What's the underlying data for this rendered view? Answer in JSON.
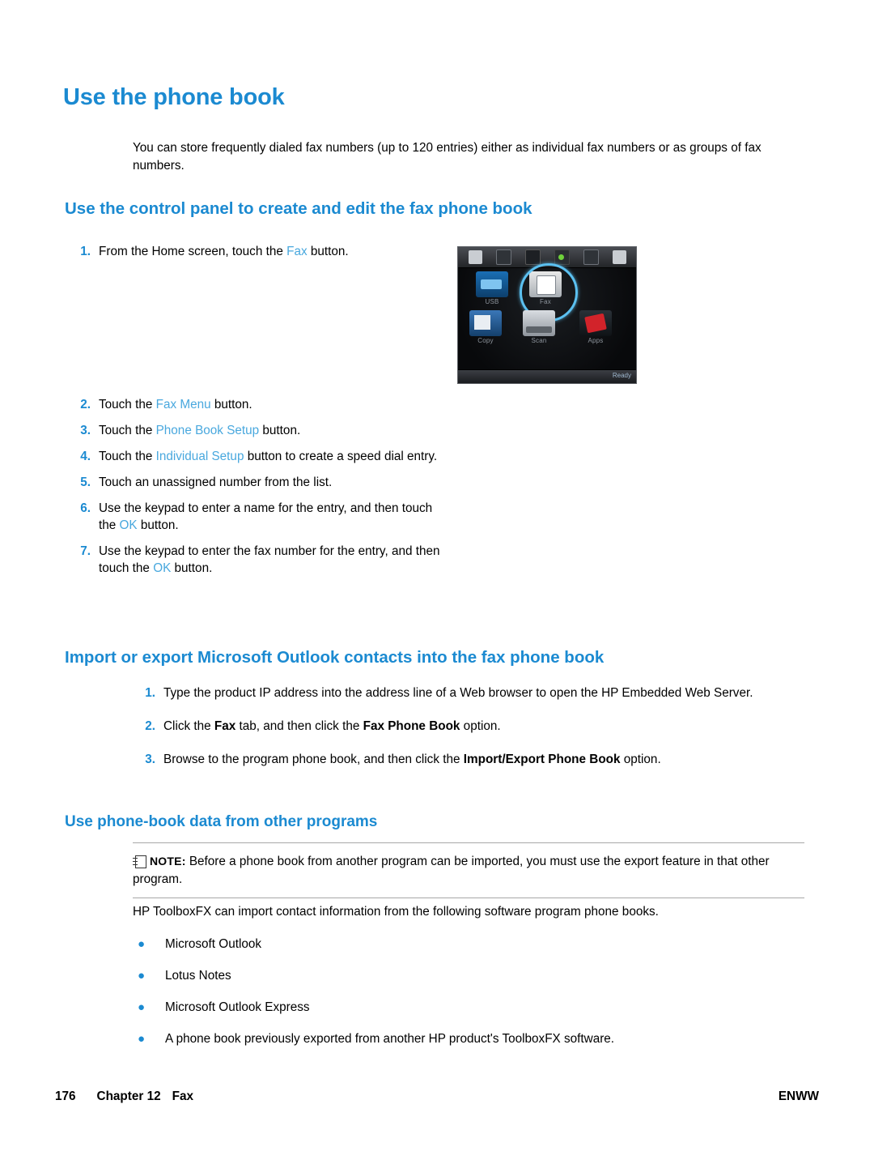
{
  "page": {
    "title": "Use the phone book",
    "intro": "You can store frequently dialed fax numbers (up to 120 entries) either as individual fax numbers or as groups of fax numbers."
  },
  "section_control_panel": {
    "heading": "Use the control panel to create and edit the fax phone book",
    "steps": [
      {
        "num": "1.",
        "pre": "From the Home screen, touch the ",
        "ui": "Fax",
        "post": " button."
      },
      {
        "num": "2.",
        "pre": "Touch the ",
        "ui": "Fax Menu",
        "post": " button."
      },
      {
        "num": "3.",
        "pre": "Touch the ",
        "ui": "Phone Book Setup",
        "post": " button."
      },
      {
        "num": "4.",
        "pre": "Touch the ",
        "ui": "Individual Setup",
        "post": " button to create a speed dial entry."
      },
      {
        "num": "5.",
        "pre": "Touch an unassigned number from the list.",
        "ui": "",
        "post": ""
      },
      {
        "num": "6.",
        "pre": "Use the keypad to enter a name for the entry, and then touch the ",
        "ui": "OK",
        "post": " button."
      },
      {
        "num": "7.",
        "pre": "Use the keypad to enter the fax number for the entry, and then touch the ",
        "ui": "OK",
        "post": " button."
      }
    ]
  },
  "control_panel_image": {
    "tiles": [
      {
        "label": "USB"
      },
      {
        "label": "Fax"
      },
      {
        "label": "Copy"
      },
      {
        "label": "Scan"
      },
      {
        "label": "Apps"
      }
    ],
    "status": "Ready"
  },
  "section_import_export": {
    "heading": "Import or export Microsoft Outlook contacts into the fax phone book",
    "steps": [
      {
        "num": "1.",
        "parts": [
          {
            "text": "Type the product IP address into the address line of a Web browser to open the HP Embedded Web Server.",
            "style": "normal"
          }
        ]
      },
      {
        "num": "2.",
        "parts": [
          {
            "text": "Click the ",
            "style": "normal"
          },
          {
            "text": "Fax",
            "style": "bold"
          },
          {
            "text": " tab, and then click the ",
            "style": "normal"
          },
          {
            "text": "Fax Phone Book",
            "style": "bold"
          },
          {
            "text": " option.",
            "style": "normal"
          }
        ]
      },
      {
        "num": "3.",
        "parts": [
          {
            "text": "Browse to the program phone book, and then click the ",
            "style": "normal"
          },
          {
            "text": "Import/Export Phone Book",
            "style": "bold"
          },
          {
            "text": " option.",
            "style": "normal"
          }
        ]
      }
    ]
  },
  "section_other_programs": {
    "heading": "Use phone-book data from other programs",
    "note": {
      "label": "NOTE:",
      "text": "Before a phone book from another program can be imported, you must use the export feature in that other program."
    },
    "lead_in": "HP ToolboxFX can import contact information from the following software program phone books.",
    "bullets": [
      "Microsoft Outlook",
      "Lotus Notes",
      "Microsoft Outlook Express",
      "A phone book previously exported from another HP product's ToolboxFX software."
    ]
  },
  "footer": {
    "page_number": "176",
    "chapter": "Chapter 12",
    "chapter_name": "Fax",
    "right": "ENWW"
  },
  "colors": {
    "heading_blue": "#1b8ad1",
    "ui_blue": "#49a8de"
  }
}
